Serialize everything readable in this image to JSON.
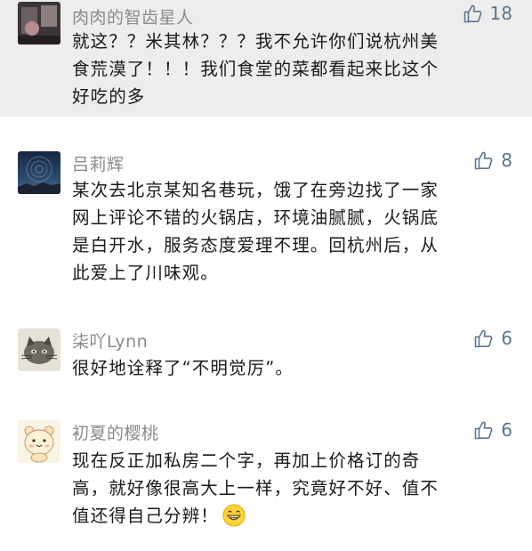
{
  "comments": [
    {
      "user": "肉肉的智齿星人",
      "likes": "18",
      "avatar_icon": "dark-photo-avatar",
      "lines": [
        "就这？？米其林？？？我不允许你们说杭州美",
        "食荒漠了！！！我们食堂的菜都看起来比这个",
        "好吃的多"
      ]
    },
    {
      "user": "吕莉辉",
      "likes": "8",
      "avatar_icon": "night-sky-avatar",
      "lines": [
        "某次去北京某知名巷玩，饿了在旁边找了一家",
        "网上评论不错的火锅店，环境油腻腻，火锅底",
        "是白开水，服务态度爱理不理。回杭州后，从",
        "此爱上了川味观。"
      ]
    },
    {
      "user": "柒吖Lynn",
      "likes": "6",
      "avatar_icon": "cat-sketch-avatar",
      "lines": [
        "很好地诠释了“不明觉厉”。"
      ]
    },
    {
      "user": "初夏的樱桃",
      "likes": "6",
      "avatar_icon": "cartoon-bear-avatar",
      "lines": [
        "现在反正加私房二个字，再加上价格订的奇",
        "高，就好像很高大上一样，究竟好不好、值不",
        "值还得自己分辨！"
      ],
      "trailing_icon": "grin-emoji-icon"
    }
  ],
  "colors": {
    "username": "#8a8a8a",
    "like_count": "#5b7590",
    "content_text": "#1a1a1a",
    "highlight_bg": "#ededed"
  }
}
